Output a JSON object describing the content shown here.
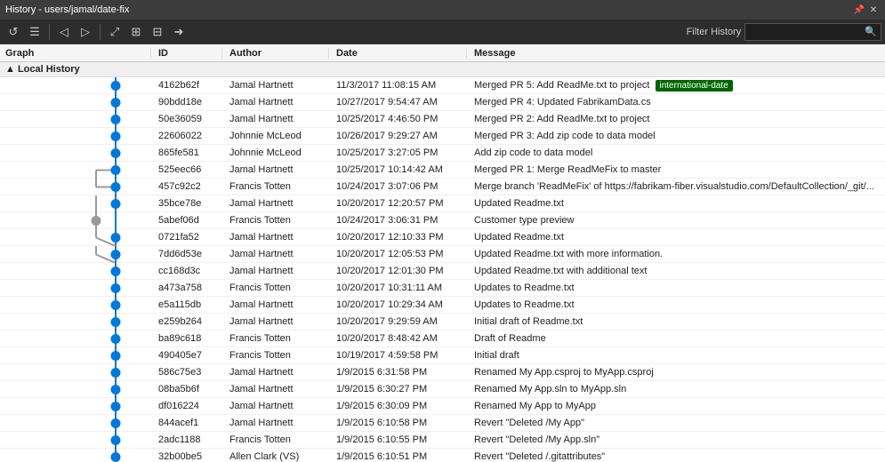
{
  "titleBar": {
    "title": "History - users/jamal/date-fix",
    "pinIcon": "📌",
    "closeLabel": "✕"
  },
  "toolbar": {
    "filterLabel": "Filter History",
    "filterPlaceholder": "",
    "buttons": [
      {
        "name": "refresh",
        "icon": "↺"
      },
      {
        "name": "list",
        "icon": "☰"
      },
      {
        "name": "back",
        "icon": "◁"
      },
      {
        "name": "forward",
        "icon": "▷"
      },
      {
        "name": "toggle",
        "icon": "⤢"
      },
      {
        "name": "filter1",
        "icon": "⊞"
      },
      {
        "name": "filter2",
        "icon": "⊟"
      },
      {
        "name": "filter3",
        "icon": "➜"
      }
    ]
  },
  "columns": {
    "graph": "Graph",
    "id": "ID",
    "author": "Author",
    "date": "Date",
    "message": "Message"
  },
  "sectionHeader": "▲ Local History",
  "rows": [
    {
      "id": "4162b62f",
      "author": "Jamal Hartnett",
      "date": "11/3/2017 11:08:15 AM",
      "message": "Merged PR 5: Add ReadMe.txt to project",
      "tag": "international-date",
      "isFirst": true,
      "isMerge": false
    },
    {
      "id": "90bdd18e",
      "author": "Jamal Hartnett",
      "date": "10/27/2017 9:54:47 AM",
      "message": "Merged PR 4: Updated FabrikamData.cs",
      "tag": "",
      "isMerge": false
    },
    {
      "id": "50e36059",
      "author": "Jamal Hartnett",
      "date": "10/25/2017 4:46:50 PM",
      "message": "Merged PR 2: Add ReadMe.txt to project",
      "tag": "",
      "isMerge": false
    },
    {
      "id": "22606022",
      "author": "Johnnie McLeod",
      "date": "10/26/2017 9:29:27 AM",
      "message": "Merged PR 3: Add zip code to data model",
      "tag": "",
      "isMerge": false
    },
    {
      "id": "865fe581",
      "author": "Johnnie McLeod",
      "date": "10/25/2017 3:27:05 PM",
      "message": "Add zip code to data model",
      "tag": "",
      "isMerge": false
    },
    {
      "id": "525eec66",
      "author": "Jamal Hartnett",
      "date": "10/25/2017 10:14:42 AM",
      "message": "Merged PR 1: Merge ReadMeFix to master",
      "tag": "",
      "isMerge": false
    },
    {
      "id": "457c92c2",
      "author": "Francis Totten",
      "date": "10/24/2017 3:07:06 PM",
      "message": "Merge branch 'ReadMeFix' of https://fabrikam-fiber.visualstudio.com/DefaultCollection/_git/...",
      "tag": "",
      "isMerge": true
    },
    {
      "id": "35bce78e",
      "author": "Jamal Hartnett",
      "date": "10/20/2017 12:20:57 PM",
      "message": "Updated Readme.txt",
      "tag": "",
      "isMerge": false
    },
    {
      "id": "5abef06d",
      "author": "Francis Totten",
      "date": "10/24/2017 3:06:31 PM",
      "message": "Customer type preview",
      "tag": "",
      "isMerge": false
    },
    {
      "id": "0721fa52",
      "author": "Jamal Hartnett",
      "date": "10/20/2017 12:10:33 PM",
      "message": "Updated Readme.txt",
      "tag": "",
      "isMerge": false
    },
    {
      "id": "7dd6d53e",
      "author": "Jamal Hartnett",
      "date": "10/20/2017 12:05:53 PM",
      "message": "Updated Readme.txt with more information.",
      "tag": "",
      "isMerge": false
    },
    {
      "id": "cc168d3c",
      "author": "Jamal Hartnett",
      "date": "10/20/2017 12:01:30 PM",
      "message": "Updated Readme.txt with additional text",
      "tag": "",
      "isMerge": false
    },
    {
      "id": "a473a758",
      "author": "Francis Totten",
      "date": "10/20/2017 10:31:11 AM",
      "message": "Updates to Readme.txt",
      "tag": "",
      "isMerge": false
    },
    {
      "id": "e5a115db",
      "author": "Jamal Hartnett",
      "date": "10/20/2017 10:29:34 AM",
      "message": "Updates to Readme.txt",
      "tag": "",
      "isMerge": false
    },
    {
      "id": "e259b264",
      "author": "Jamal Hartnett",
      "date": "10/20/2017 9:29:59 AM",
      "message": "Initial draft of Readme.txt",
      "tag": "",
      "isMerge": false
    },
    {
      "id": "ba89c618",
      "author": "Francis Totten",
      "date": "10/20/2017 8:48:42 AM",
      "message": "Draft of Readme",
      "tag": "",
      "isMerge": false
    },
    {
      "id": "490405e7",
      "author": "Francis Totten",
      "date": "10/19/2017 4:59:58 PM",
      "message": "Initial draft",
      "tag": "",
      "isMerge": false
    },
    {
      "id": "586c75e3",
      "author": "Jamal Hartnett",
      "date": "1/9/2015 6:31:58 PM",
      "message": "Renamed My App.csproj to MyApp.csproj",
      "tag": "",
      "isMerge": false
    },
    {
      "id": "08ba5b6f",
      "author": "Jamal Hartnett",
      "date": "1/9/2015 6:30:27 PM",
      "message": "Renamed My App.sln to MyApp.sln",
      "tag": "",
      "isMerge": false
    },
    {
      "id": "df016224",
      "author": "Jamal Hartnett",
      "date": "1/9/2015 6:30:09 PM",
      "message": "Renamed My App to MyApp",
      "tag": "",
      "isMerge": false
    },
    {
      "id": "844acef1",
      "author": "Jamal Hartnett",
      "date": "1/9/2015 6:10:58 PM",
      "message": "Revert \"Deleted /My App\"",
      "tag": "",
      "isMerge": false
    },
    {
      "id": "2adc1188",
      "author": "Francis Totten",
      "date": "1/9/2015 6:10:55 PM",
      "message": "Revert \"Deleted /My App.sln\"",
      "tag": "",
      "isMerge": false
    },
    {
      "id": "32b00be5",
      "author": "Allen Clark (VS)",
      "date": "1/9/2015 6:10:51 PM",
      "message": "Revert \"Deleted /.gitattributes\"",
      "tag": "",
      "isMerge": false
    }
  ]
}
